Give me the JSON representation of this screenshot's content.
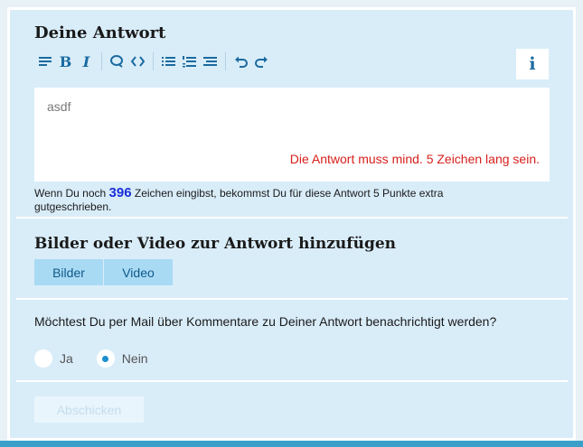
{
  "answer": {
    "title": "Deine Antwort",
    "info_label": "i",
    "toolbar": [
      {
        "name": "paragraph-icon"
      },
      {
        "name": "bold-icon",
        "glyph": "B"
      },
      {
        "name": "italic-icon",
        "glyph": "I"
      },
      {
        "name": "quote-icon"
      },
      {
        "name": "code-icon"
      },
      {
        "name": "bullet-list-icon"
      },
      {
        "name": "numbered-list-icon"
      },
      {
        "name": "indent-icon"
      },
      {
        "name": "undo-icon"
      },
      {
        "name": "redo-icon"
      }
    ],
    "editor_value": "asdf",
    "error": "Die Antwort muss mind. 5 Zeichen lang sein.",
    "hint_prefix": "Wenn Du noch",
    "hint_count": "396",
    "hint_suffix": "Zeichen eingibst, bekommst Du für diese Antwort 5 Punkte extra gutgeschrieben."
  },
  "media": {
    "title": "Bilder oder Video zur Antwort hinzufügen",
    "tabs": [
      "Bilder",
      "Video"
    ]
  },
  "notify": {
    "question": "Möchtest Du per Mail über Kommentare zu Deiner Antwort benachrichtigt werden?",
    "options": [
      "Ja",
      "Nein"
    ],
    "selected": "Nein"
  },
  "submit_label": "Abschicken",
  "colors": {
    "panel": "#d9edf9",
    "accent": "#1b6aa0",
    "error": "#d6201c",
    "count": "#1a2fd6"
  }
}
